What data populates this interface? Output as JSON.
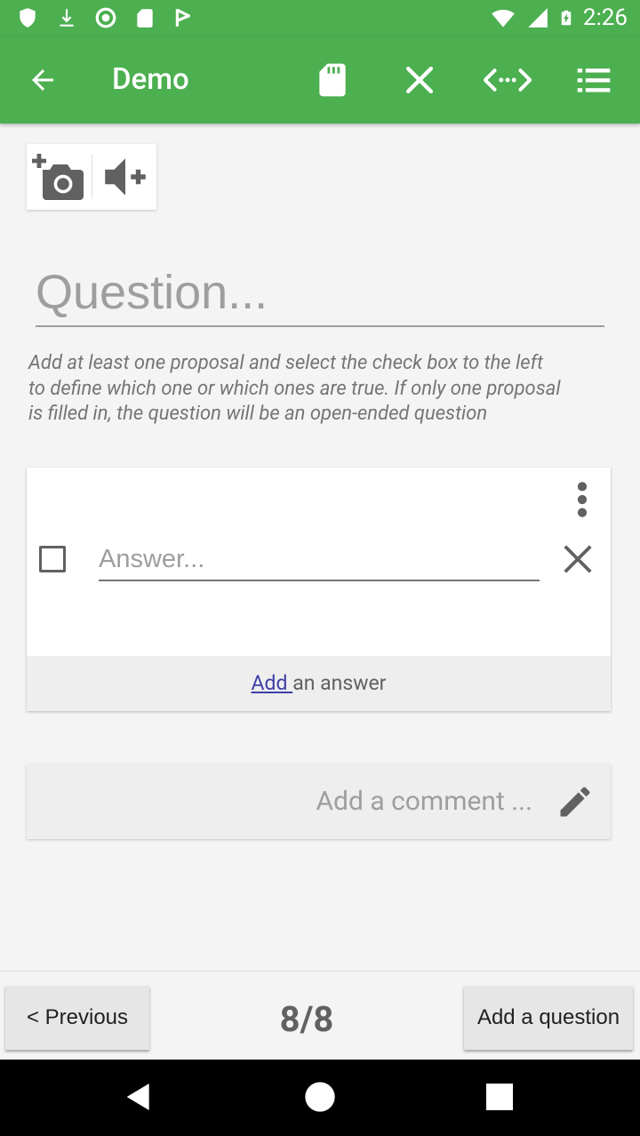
{
  "status_bar": {
    "time": "2:26",
    "icons": [
      "shield-icon",
      "download-icon",
      "circle-icon",
      "sd-card-icon",
      "flag-icon",
      "wifi-icon",
      "signal-icon",
      "battery-charging-icon"
    ]
  },
  "app_bar": {
    "title": "Demo",
    "back_icon": "arrow-back-icon",
    "actions": [
      "sd-card-icon",
      "close-icon",
      "code-icon",
      "list-icon"
    ]
  },
  "media": {
    "add_photo_icon": "add-photo-icon",
    "add_audio_icon": "add-audio-icon"
  },
  "question": {
    "placeholder": "Question..."
  },
  "hint": "Add at least one proposal and select the check box to the left to define which one or which ones are true. If only one proposal is filled in, the question will be an open-ended question",
  "answer": {
    "placeholder": "Answer...",
    "checked": false,
    "footer_link": "Add ",
    "footer_text": "an answer"
  },
  "comment": {
    "placeholder": "Add a comment ..."
  },
  "nav": {
    "previous_label": "< Previous",
    "page_counter": "8/8",
    "add_question_label": "Add a question"
  },
  "colors": {
    "primary": "#4caf50",
    "link": "#3f3fa8"
  }
}
